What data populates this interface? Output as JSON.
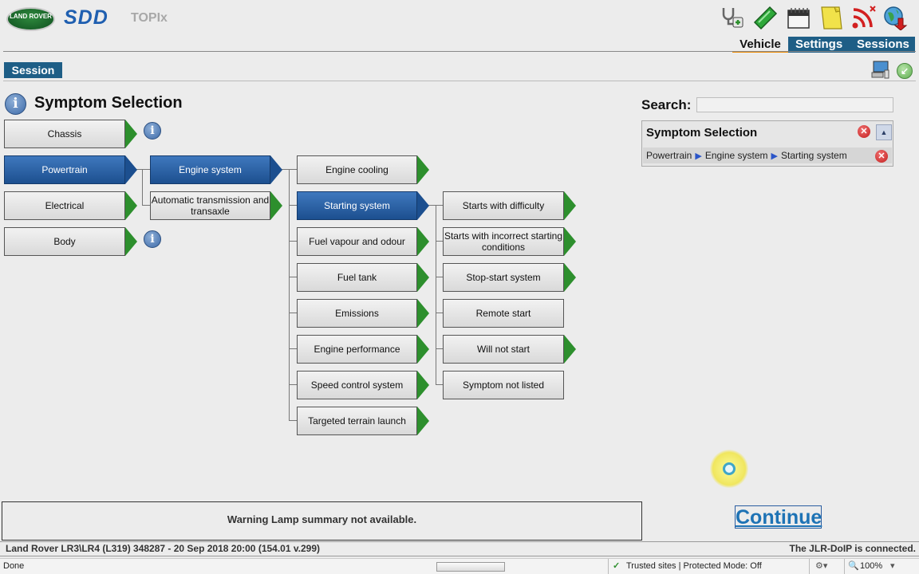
{
  "header": {
    "brand_logo": "LAND ROVER",
    "app_name": "SDD",
    "module_name": "TOPIx",
    "toolbar_icons": [
      "stethoscope-icon",
      "green-tool-icon",
      "calendar-icon",
      "notes-icon",
      "feed-icon",
      "globe-icon"
    ],
    "tabs": [
      "Vehicle",
      "Settings",
      "Sessions"
    ],
    "accent_color": "#1e5e86",
    "active_tab_underline": "#f08c00"
  },
  "session_label": "Session",
  "page_title": "Symptom Selection",
  "tree": {
    "col1": [
      "Chassis",
      "Powertrain",
      "Electrical",
      "Body"
    ],
    "col2": [
      "Engine system",
      "Automatic transmission and transaxle"
    ],
    "col3": [
      "Engine cooling",
      "Starting system",
      "Fuel vapour and odour",
      "Fuel tank",
      "Emissions",
      "Engine performance",
      "Speed control system",
      "Targeted terrain launch"
    ],
    "col4": [
      "Starts with difficulty",
      "Starts with incorrect starting conditions",
      "Stop-start system",
      "Remote start",
      "Will not start",
      "Symptom not listed"
    ],
    "selected": [
      "Powertrain",
      "Engine system",
      "Starting system"
    ],
    "selected_color": "#1c4f8f",
    "arrow_color": "#2d8f2d"
  },
  "search": {
    "label": "Search:",
    "value": ""
  },
  "selection_panel": {
    "title": "Symptom Selection",
    "path": [
      "Powertrain",
      "Engine system",
      "Starting system"
    ]
  },
  "warning_text": "Warning Lamp summary not available.",
  "continue_label": "Continue",
  "status": {
    "vehicle_info": "Land Rover LR3\\LR4 (L319) 348287 - 20 Sep 2018 20:00 (154.01 v.299)",
    "connection": "The JLR-DoIP is connected.",
    "browser_status": "Done",
    "zone": "Trusted sites | Protected Mode: Off",
    "zoom": "100%"
  }
}
